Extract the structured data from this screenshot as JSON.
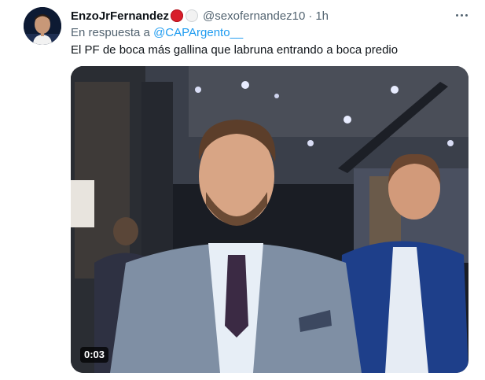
{
  "tweet": {
    "display_name": "EnzoJrFernandez",
    "badges": [
      "red-circle-emoji",
      "white-circle-emoji"
    ],
    "handle": "@sexofernandez10",
    "separator": "·",
    "time": "1h",
    "reply_prefix": "En respuesta a",
    "reply_mention": "@CAPArgento__",
    "text": "El PF de boca más gallina que labruna entrando a boca predio",
    "video": {
      "duration": "0:03"
    }
  },
  "colors": {
    "text_primary": "#0f1419",
    "text_secondary": "#536471",
    "link": "#1d9bf0"
  },
  "icons": {
    "more": "more-horizontal-icon"
  }
}
